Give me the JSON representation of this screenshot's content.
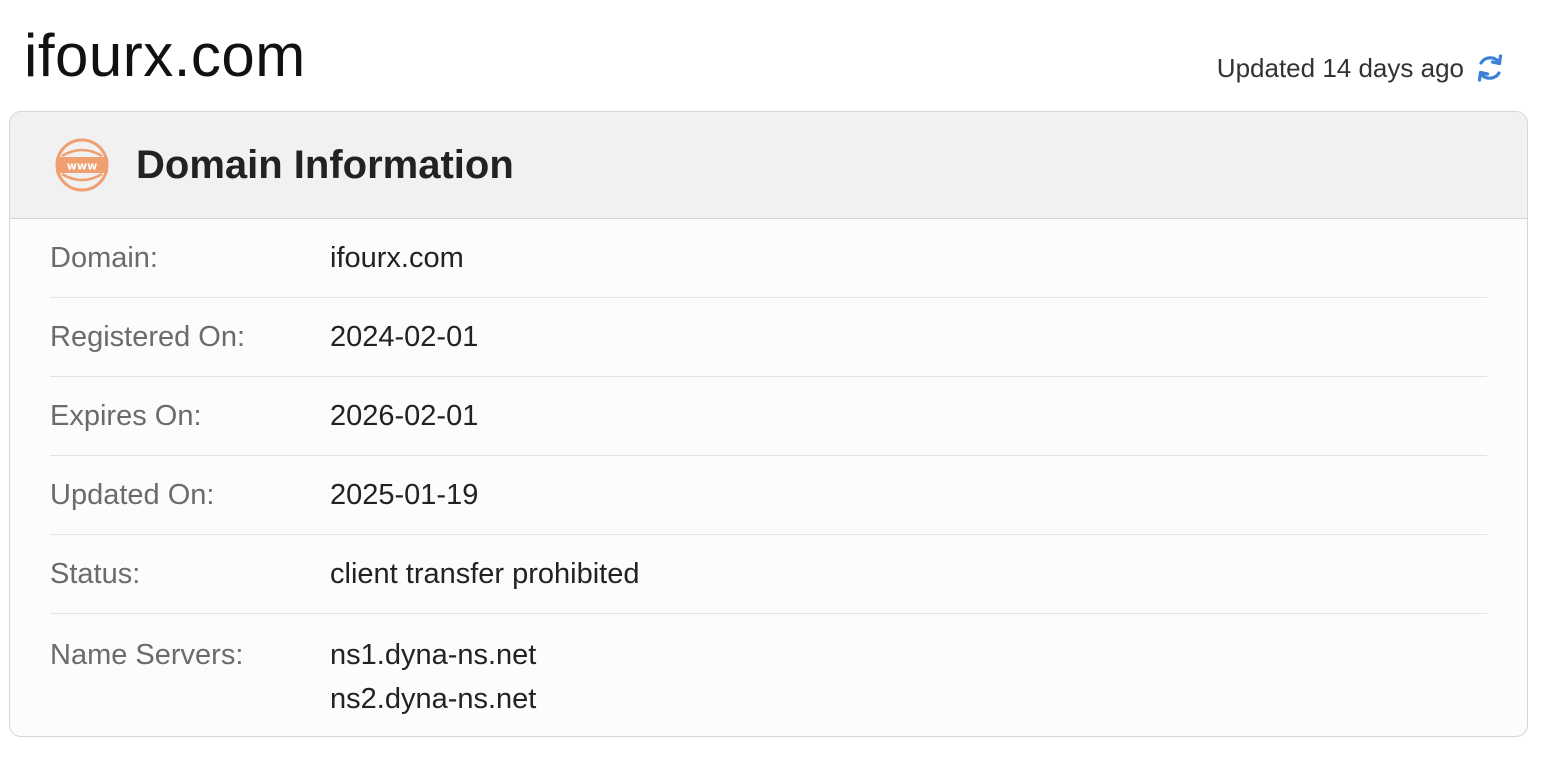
{
  "header": {
    "domain_title": "ifourx.com",
    "updated_text": "Updated 14 days ago",
    "refresh_icon": "refresh-icon",
    "accent_color": "#3b82d6"
  },
  "card": {
    "title": "Domain Information",
    "icon": "www-icon",
    "icon_color": "#f0a070",
    "rows": [
      {
        "label": "Domain:",
        "value": "ifourx.com"
      },
      {
        "label": "Registered On:",
        "value": "2024-02-01"
      },
      {
        "label": "Expires On:",
        "value": "2026-02-01"
      },
      {
        "label": "Updated On:",
        "value": "2025-01-19"
      },
      {
        "label": "Status:",
        "value": "client transfer prohibited"
      }
    ],
    "name_servers": {
      "label": "Name Servers:",
      "values": [
        "ns1.dyna-ns.net",
        "ns2.dyna-ns.net"
      ]
    }
  }
}
